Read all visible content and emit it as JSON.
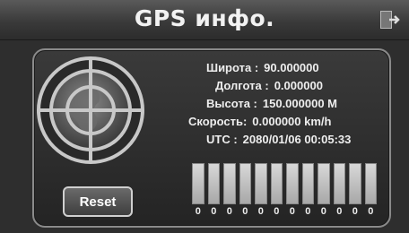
{
  "header": {
    "title": "GPS инфо."
  },
  "info": {
    "latitude": {
      "label": "Широта :",
      "value": "90.000000"
    },
    "longitude": {
      "label": "Долгота :",
      "value": "0.000000"
    },
    "altitude": {
      "label": "Высота :",
      "value": "150.000000 M"
    },
    "speed": {
      "label": "Скорость:",
      "value": "0.000000 km/h"
    },
    "utc": {
      "label": "UTC :",
      "value": "2080/01/06 00:05:33"
    }
  },
  "satellites": {
    "snr": [
      "0",
      "0",
      "0",
      "0",
      "0",
      "0",
      "0",
      "0",
      "0",
      "0",
      "0",
      "0"
    ]
  },
  "buttons": {
    "reset_label": "Reset"
  },
  "icons": {
    "exit": "exit-icon",
    "globe": "globe-crosshair-icon"
  }
}
